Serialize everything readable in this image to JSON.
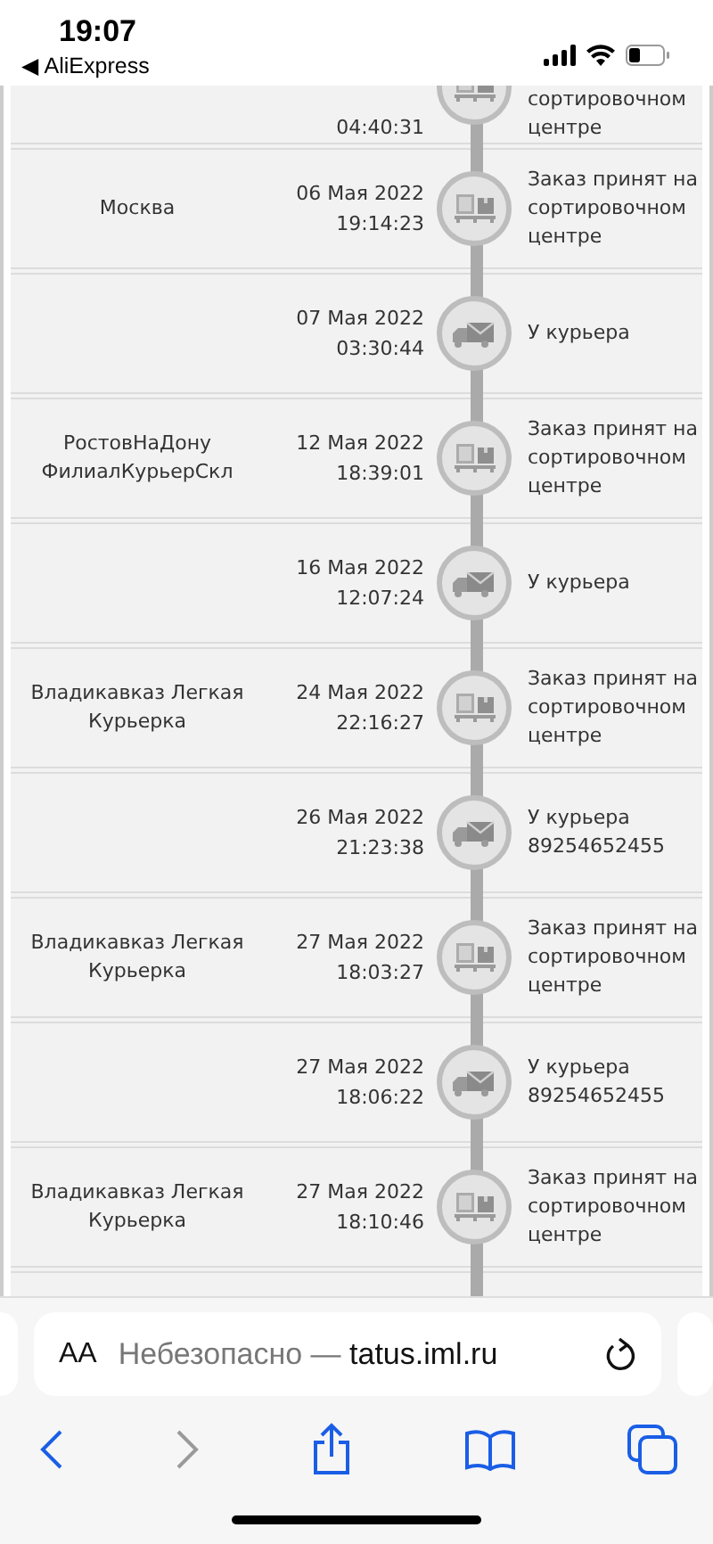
{
  "status_bar": {
    "time": "19:07",
    "back_app": "◀ AliExpress"
  },
  "events": [
    {
      "time": "04:40:31",
      "status": "сортировочном центре",
      "kind": "box",
      "partial": true
    },
    {
      "city": "Москва",
      "date": "06 Мая 2022",
      "time": "19:14:23",
      "status": "Заказ принят на сортировочном центре",
      "kind": "box",
      "partial": false
    },
    {
      "date": "07 Мая 2022",
      "time": "03:30:44",
      "status": "У курьера",
      "kind": "truck",
      "partial": false
    },
    {
      "city": "РостовНаДону ФилиалКурьерСкл",
      "date": "12 Мая 2022",
      "time": "18:39:01",
      "status": "Заказ принят на сортировочном центре",
      "kind": "box",
      "partial": false
    },
    {
      "date": "16 Мая 2022",
      "time": "12:07:24",
      "status": "У курьера",
      "kind": "truck",
      "partial": false
    },
    {
      "city": "Владикавказ Легкая Курьерка",
      "date": "24 Мая 2022",
      "time": "22:16:27",
      "status": "Заказ принят на сортировочном центре",
      "kind": "box",
      "partial": false
    },
    {
      "date": "26 Мая 2022",
      "time": "21:23:38",
      "status": "У курьера 89254652455",
      "kind": "truck",
      "partial": false
    },
    {
      "city": "Владикавказ Легкая Курьерка",
      "date": "27 Мая 2022",
      "time": "18:03:27",
      "status": "Заказ принят на сортировочном центре",
      "kind": "box",
      "partial": false
    },
    {
      "date": "27 Мая 2022",
      "time": "18:06:22",
      "status": "У курьера 89254652455",
      "kind": "truck",
      "partial": false
    },
    {
      "city": "Владикавказ Легкая Курьерка",
      "date": "27 Мая 2022",
      "time": "18:10:46",
      "status": "Заказ принят на сортировочном центре",
      "kind": "box",
      "partial": false
    }
  ],
  "address_bar": {
    "text_size": "AA",
    "insecure": "Небезопасно —",
    "url": "tatus.iml.ru"
  }
}
